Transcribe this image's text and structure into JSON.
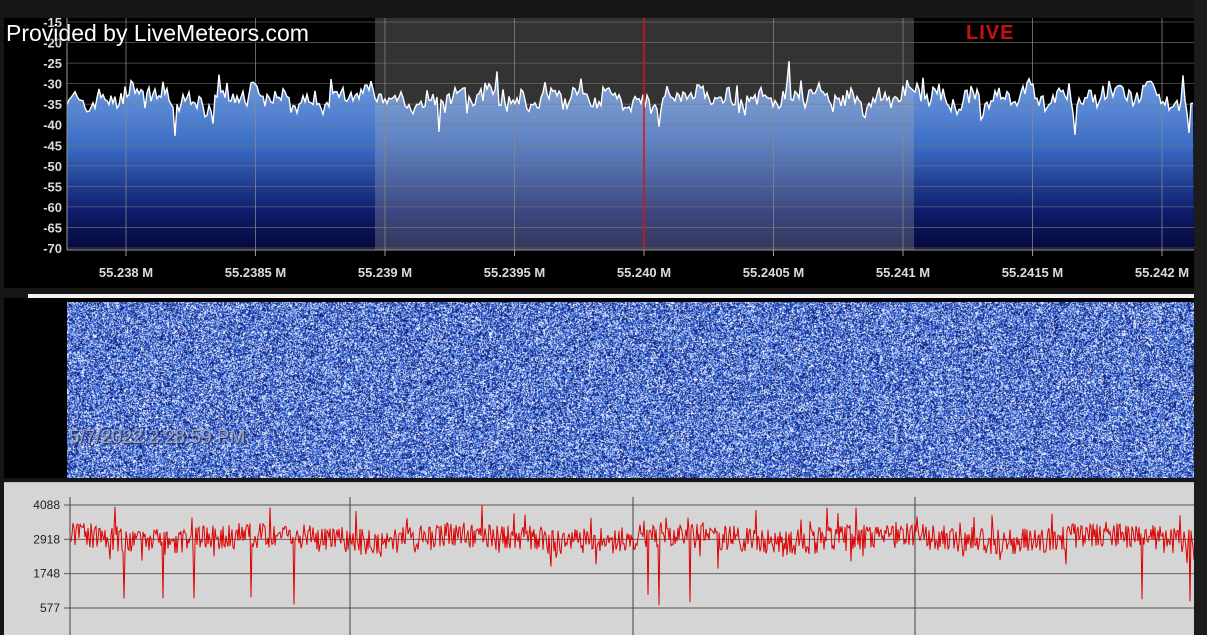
{
  "app": {
    "provider_text": "Provided by LiveMeteors.com",
    "live_label": "LIVE",
    "timestamp": "5/7/2022 2:28:59 PM"
  },
  "spectrum": {
    "y_ticks": [
      "-15",
      "-20",
      "-25",
      "-30",
      "-35",
      "-40",
      "-45",
      "-50",
      "-55",
      "-60",
      "-65",
      "-70"
    ],
    "x_ticks": [
      "55.238 M",
      "55.2385 M",
      "55.239 M",
      "55.2395 M",
      "55.240 M",
      "55.2405 M",
      "55.241 M",
      "55.2415 M",
      "55.242 M"
    ],
    "center_frequency": "55.240 M",
    "colors": {
      "fill_top": "#6f9fe0",
      "fill_bottom": "#050838",
      "trace": "#ffffff",
      "center_line": "#e01010",
      "grid": "#8a8a8a"
    }
  },
  "waterfall": {
    "colors": {
      "high": "#f0f6ff",
      "mid": "#2f5fd8",
      "low": "#0a1a6a"
    }
  },
  "amplitude": {
    "y_ticks": [
      "4088",
      "2918",
      "1748",
      "577"
    ],
    "colors": {
      "trace": "#dd0000",
      "background": "#d5d5d5",
      "grid": "#555555"
    }
  }
}
